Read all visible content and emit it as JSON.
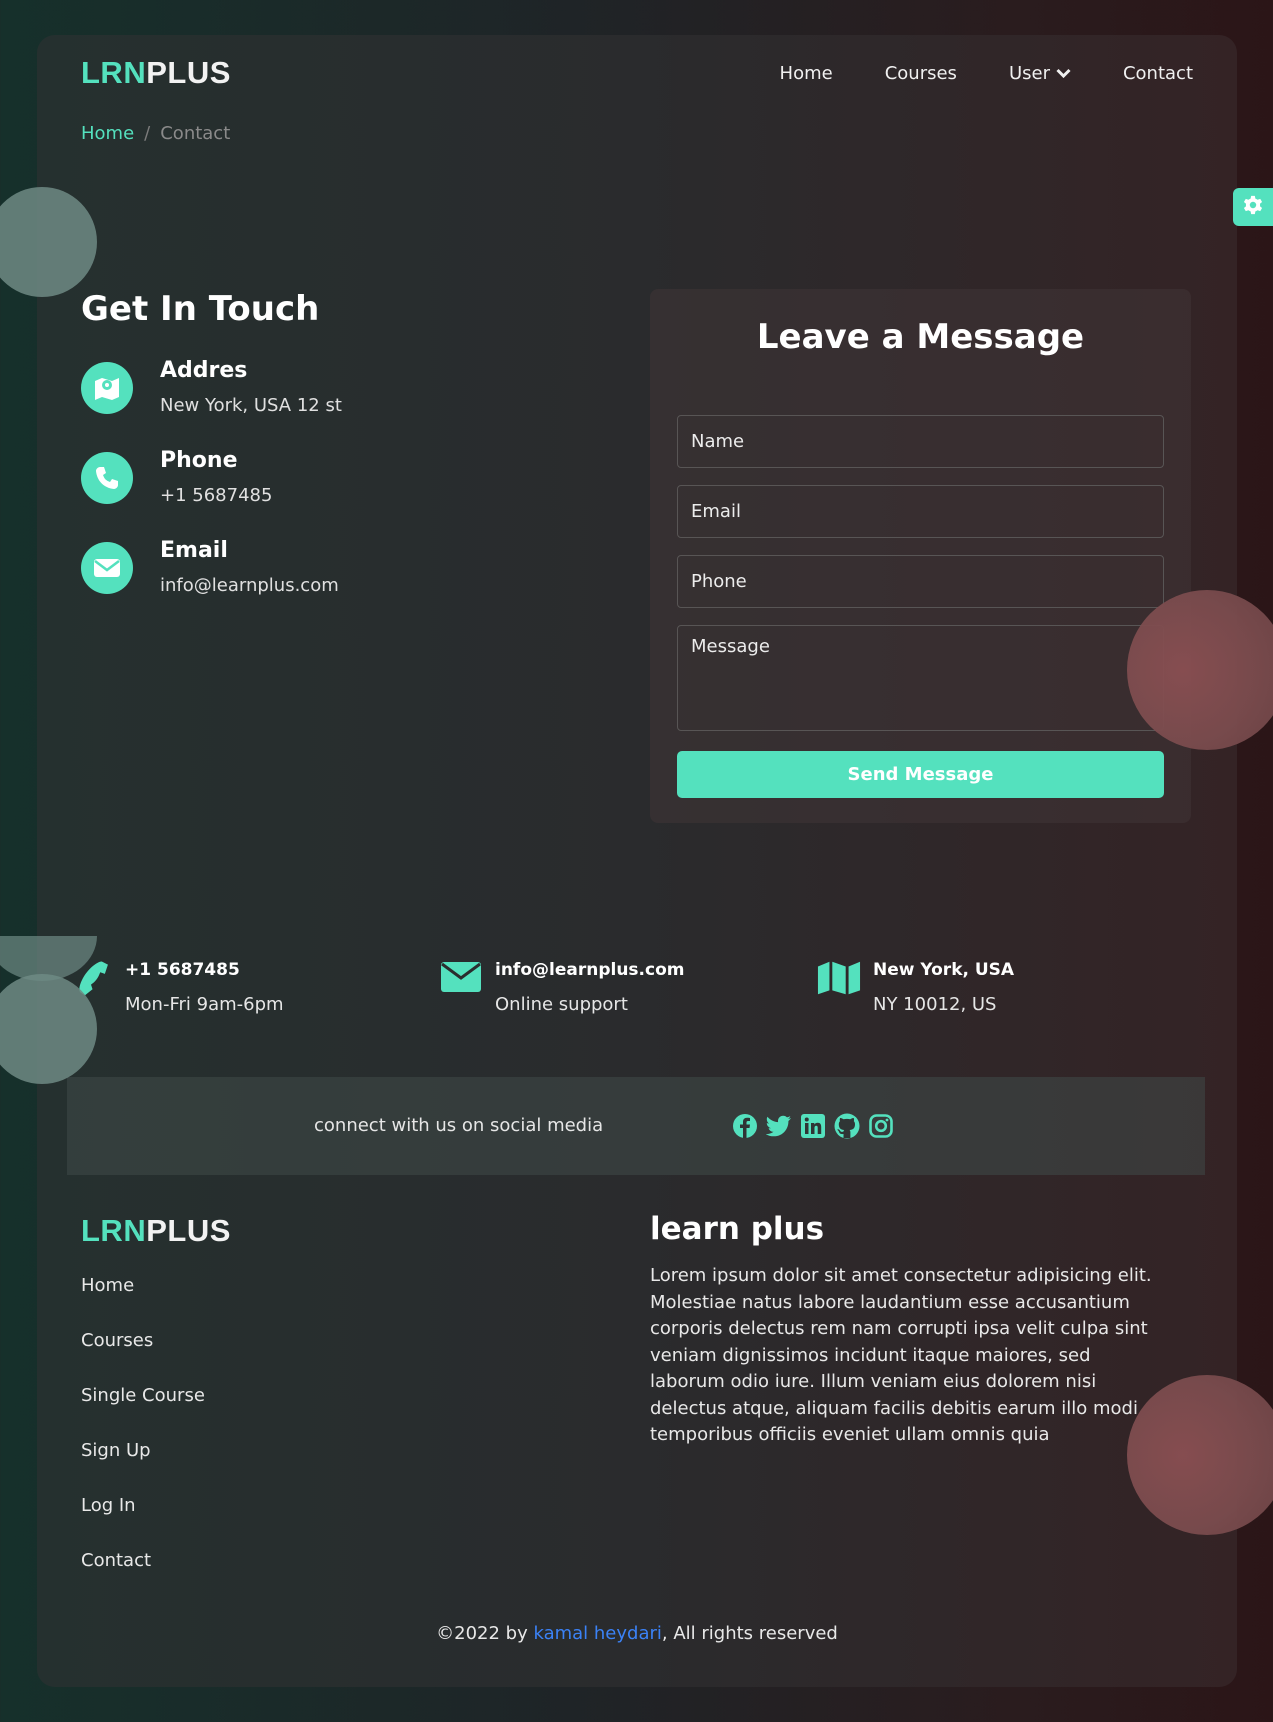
{
  "brand": {
    "part1": "LRN",
    "part2": "PLUS"
  },
  "nav": {
    "home": "Home",
    "courses": "Courses",
    "user": "User",
    "contact": "Contact"
  },
  "breadcrumb": {
    "home": "Home",
    "separator": "/",
    "current": "Contact"
  },
  "get_in_touch": {
    "title": "Get In Touch",
    "items": [
      {
        "title": "Addres",
        "value": "New York, USA 12 st"
      },
      {
        "title": "Phone",
        "value": "+1 5687485"
      },
      {
        "title": "Email",
        "value": "info@learnplus.com"
      }
    ]
  },
  "form": {
    "title": "Leave a Message",
    "name_placeholder": "Name",
    "email_placeholder": "Email",
    "phone_placeholder": "Phone",
    "message_placeholder": "Message",
    "send_label": "Send Message"
  },
  "contact_strip": [
    {
      "title": "+1 5687485",
      "sub": "Mon-Fri 9am-6pm"
    },
    {
      "title": "info@learnplus.com",
      "sub": "Online support"
    },
    {
      "title": "New York, USA",
      "sub": "NY 10012, US"
    }
  ],
  "social": {
    "text": "connect with us on social media"
  },
  "footer": {
    "links": [
      "Home",
      "Courses",
      "Single Course",
      "Sign Up",
      "Log In",
      "Contact"
    ],
    "about_title": "learn plus",
    "about_text": "Lorem ipsum dolor sit amet consectetur adipisicing elit. Molestiae natus labore laudantium esse accusantium corporis delectus rem nam corrupti ipsa velit culpa sint veniam dignissimos incidunt itaque maiores, sed laborum odio iure. Illum veniam eius dolorem nisi delectus atque, aliquam facilis debitis earum illo modi temporibus officiis eveniet ullam omnis quia",
    "copyright_prefix": "©2022 by ",
    "copyright_author": "kamal heydari",
    "copyright_suffix": ", All rights reserved"
  },
  "colors": {
    "accent": "#54e1be",
    "link": "#3b82f6"
  }
}
